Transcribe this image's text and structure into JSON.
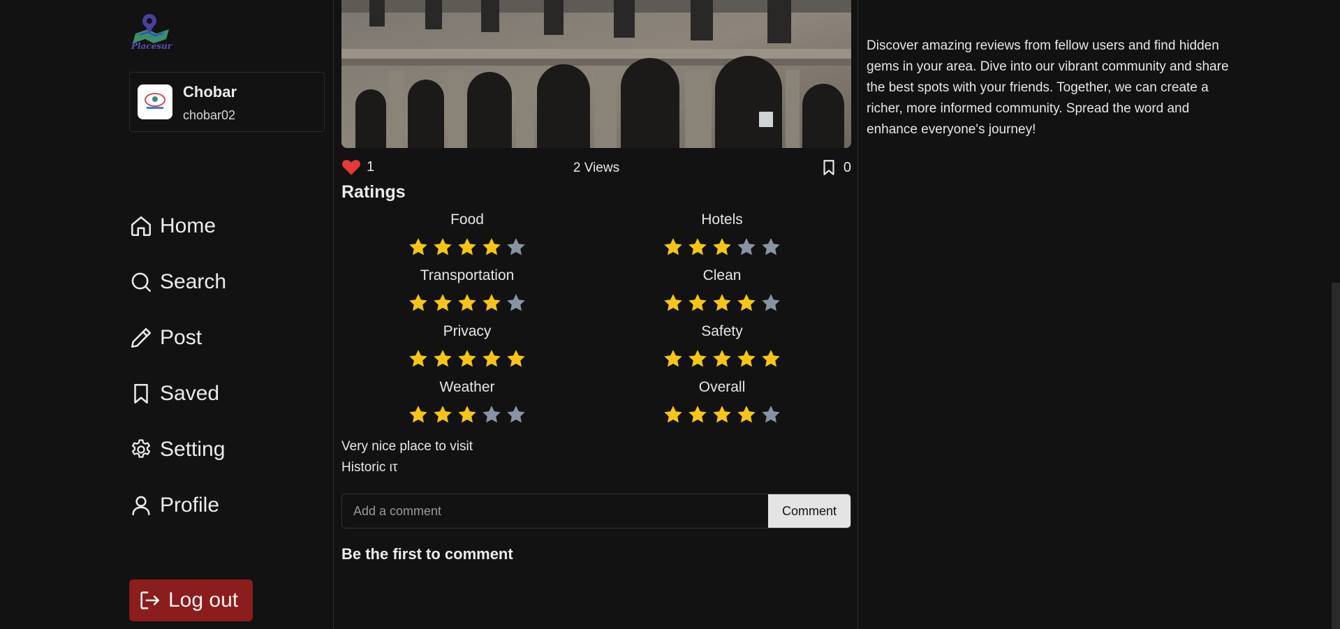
{
  "app": {
    "logo_text": "Placesur"
  },
  "user": {
    "name": "Chobar",
    "handle": "chobar02",
    "avatar_text": "PLACESUR"
  },
  "nav": {
    "items": [
      {
        "label": "Home",
        "icon": "home-icon"
      },
      {
        "label": "Search",
        "icon": "search-icon"
      },
      {
        "label": "Post",
        "icon": "pencil-icon"
      },
      {
        "label": "Saved",
        "icon": "bookmark-icon"
      },
      {
        "label": "Setting",
        "icon": "gear-icon"
      },
      {
        "label": "Profile",
        "icon": "user-icon"
      }
    ],
    "logout_label": "Log out"
  },
  "post": {
    "likes": "1",
    "views": "2 Views",
    "saves": "0",
    "ratings_title": "Ratings",
    "ratings": [
      {
        "label": "Food",
        "stars": 4
      },
      {
        "label": "Hotels",
        "stars": 3
      },
      {
        "label": "Transportation",
        "stars": 4
      },
      {
        "label": "Clean",
        "stars": 4
      },
      {
        "label": "Privacy",
        "stars": 5
      },
      {
        "label": "Safety",
        "stars": 5
      },
      {
        "label": "Weather",
        "stars": 3
      },
      {
        "label": "Overall",
        "stars": 4
      }
    ],
    "max_stars": 5,
    "description": "Very nice place to visit",
    "tag": "Historic ιτ"
  },
  "comments": {
    "placeholder": "Add a comment",
    "button_label": "Comment",
    "empty_text": "Be the first to comment"
  },
  "sidebar_right": {
    "text": "Discover amazing reviews from fellow users and find hidden gems in your area. Dive into our vibrant community and share the best spots with your friends. Together, we can create a richer, more informed community. Spread the word and enhance everyone's journey!"
  },
  "colors": {
    "star_filled": "#f5c518",
    "star_empty": "#8a93a3",
    "heart": "#e53935",
    "logout_bg": "#8b1d1d"
  }
}
